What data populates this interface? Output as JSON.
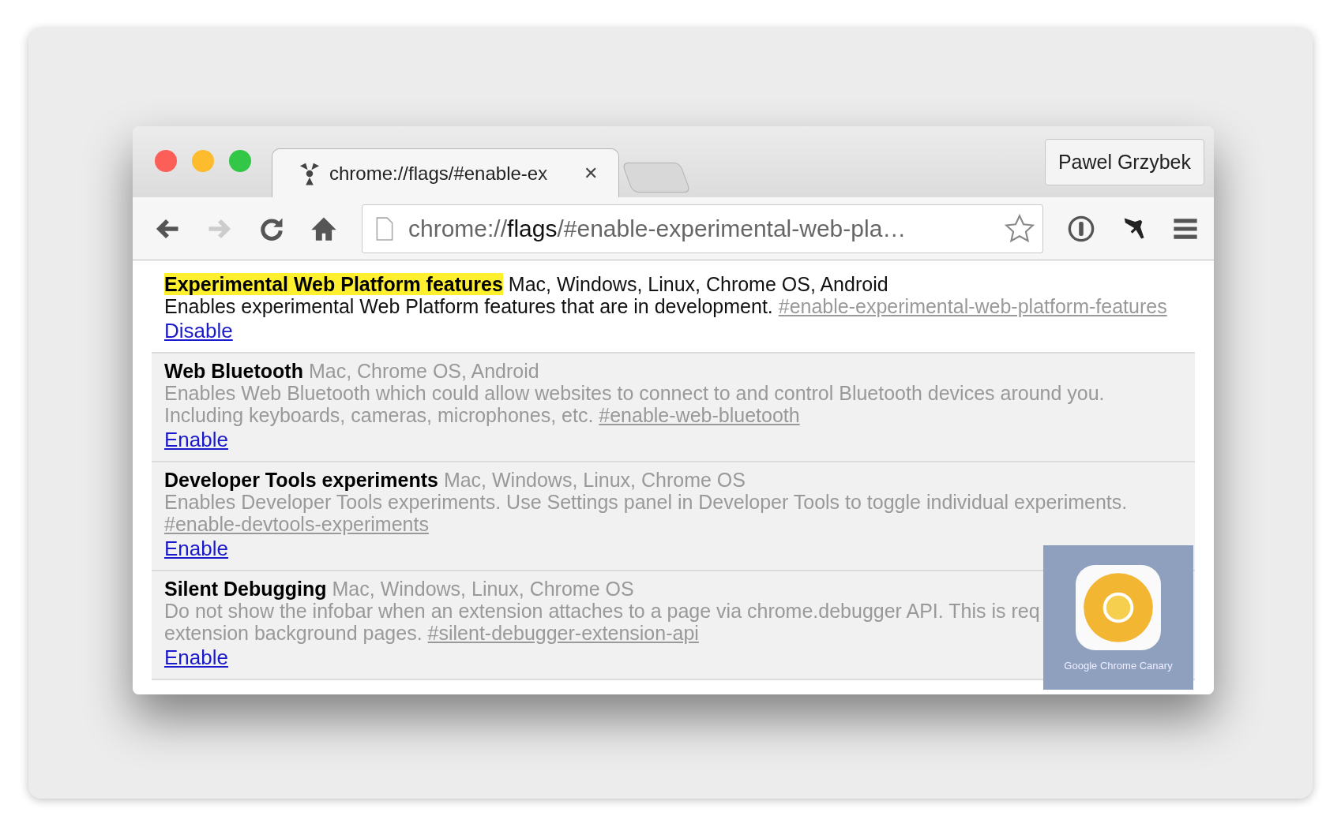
{
  "tab": {
    "title": "chrome://flags/#enable-ex",
    "close": "✕",
    "selected": true
  },
  "profile": {
    "name": "Pawel Grzybek"
  },
  "address_bar": {
    "url": "chrome://**flags**/#enable-experimental-web-pla…"
  },
  "flags": [
    {
      "name": "Experimental Web Platform features",
      "highlighted": true,
      "platforms": "Mac, Windows, Linux, Chrome OS, Android",
      "enabled": true,
      "description": "Enables experimental Web Platform features that are in development.",
      "anchor": "#enable-experimental-web-platform-features",
      "action": "Disable"
    },
    {
      "name": "Web Bluetooth",
      "highlighted": false,
      "platforms": "Mac, Chrome OS, Android",
      "enabled": false,
      "description": "Enables Web Bluetooth which could allow websites to connect to and control Bluetooth devices around you.\nIncluding keyboards, cameras, microphones, etc.",
      "anchor": "#enable-web-bluetooth",
      "action": "Enable"
    },
    {
      "name": "Developer Tools experiments",
      "highlighted": false,
      "platforms": "Mac, Windows, Linux, Chrome OS",
      "enabled": false,
      "description": "Enables Developer Tools experiments. Use Settings panel in Developer Tools to toggle individual experiments.\n",
      "anchor": "#enable-devtools-experiments",
      "action": "Enable"
    },
    {
      "name": "Silent Debugging",
      "highlighted": false,
      "platforms": "Mac, Windows, Linux, Chrome OS",
      "enabled": false,
      "description": "Do not show the infobar when an extension attaches to a page via chrome.debugger API. This is req\nextension background pages.",
      "anchor": "#silent-debugger-extension-api",
      "action": "Enable"
    }
  ],
  "app_badge": {
    "label": "Google Chrome Canary"
  }
}
